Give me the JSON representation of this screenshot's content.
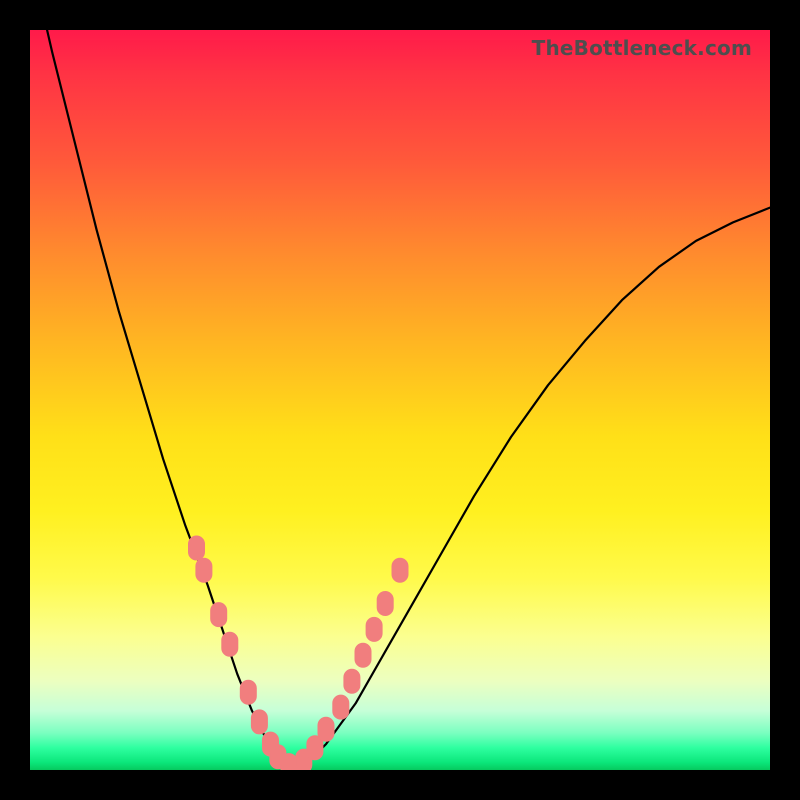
{
  "watermark": "TheBottleneck.com",
  "colors": {
    "curve": "#000000",
    "marker_fill": "#f17e7e",
    "marker_stroke": "#f17e7e",
    "frame_bg": "#000000"
  },
  "chart_data": {
    "type": "line",
    "title": "",
    "xlabel": "",
    "ylabel": "",
    "xlim": [
      0,
      100
    ],
    "ylim": [
      0,
      100
    ],
    "grid": false,
    "legend": false,
    "series": [
      {
        "name": "bottleneck-curve",
        "x": [
          0,
          3,
          6,
          9,
          12,
          15,
          18,
          21,
          24,
          26,
          28,
          30,
          31.5,
          33,
          34.5,
          36,
          38,
          40,
          44,
          48,
          52,
          56,
          60,
          65,
          70,
          75,
          80,
          85,
          90,
          95,
          100
        ],
        "values": [
          110,
          97,
          85,
          73,
          62,
          52,
          42,
          33,
          25,
          19,
          13,
          8,
          5,
          2.5,
          1,
          0.5,
          1.5,
          3.5,
          9,
          16,
          23,
          30,
          37,
          45,
          52,
          58,
          63.5,
          68,
          71.5,
          74,
          76
        ]
      }
    ],
    "left_markers": {
      "x": [
        22.5,
        23.5,
        25.5,
        27,
        29.5,
        31,
        32.5,
        33.5,
        35
      ],
      "y": [
        30,
        27,
        21,
        17,
        10.5,
        6.5,
        3.5,
        1.8,
        0.6
      ]
    },
    "right_markers": {
      "x": [
        37,
        38.5,
        40,
        42,
        43.5,
        45,
        46.5,
        48,
        50
      ],
      "y": [
        1.2,
        3,
        5.5,
        8.5,
        12,
        15.5,
        19,
        22.5,
        27
      ]
    }
  }
}
